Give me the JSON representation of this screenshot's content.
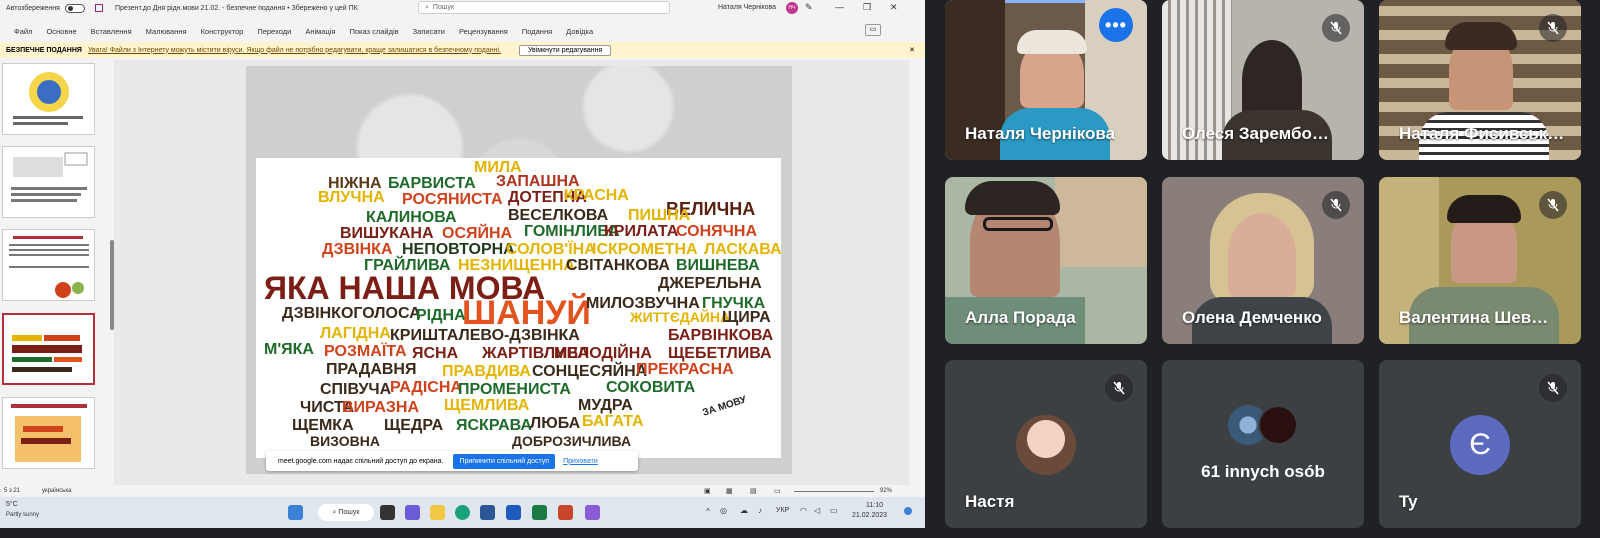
{
  "titlebar": {
    "autosave_label": "Автозбереження",
    "doc_title": "Презент.до Дня рідн.мови 21.02. - безпечне подання • Збережено у цей ПК",
    "search_placeholder": "Пошук",
    "user_name": "Наталя Чернікова",
    "user_initials": "НЧ"
  },
  "ribbon": {
    "tabs": [
      "Файл",
      "Основне",
      "Вставлення",
      "Малювання",
      "Конструктор",
      "Переходи",
      "Анімація",
      "Показ слайдів",
      "Записати",
      "Рецензування",
      "Подання",
      "Довідка"
    ]
  },
  "infobar": {
    "title": "БЕЗПЕЧНЕ ПОДАННЯ",
    "message": "Увага! Файли з Інтернету можуть містити віруси. Якщо файл не потрібно редагувати, краще залишатися в безпечному поданні.",
    "enable_button": "Увімкнути редагування"
  },
  "slide": {
    "words": [
      {
        "t": "МИЛА",
        "c": "#e3b400"
      },
      {
        "t": "НІЖНА",
        "c": "#5a3b1b"
      },
      {
        "t": "БАРВИСТА",
        "c": "#1f6b2b"
      },
      {
        "t": "ЗАПАШНА",
        "c": "#b0331e"
      },
      {
        "t": "ВЛУЧНА",
        "c": "#e3b400"
      },
      {
        "t": "РОСЯНИСТА",
        "c": "#d0421b"
      },
      {
        "t": "ДОТЕПНА",
        "c": "#7a1e16"
      },
      {
        "t": "КРАСНА",
        "c": "#e3b400"
      },
      {
        "t": "ВЕЛИЧНА",
        "c": "#5a2010"
      },
      {
        "t": "КАЛИНОВА",
        "c": "#1f6b2b"
      },
      {
        "t": "ВЕСЕЛКОВА",
        "c": "#3b2a1a"
      },
      {
        "t": "ПИШНА",
        "c": "#e3b400"
      },
      {
        "t": "ВИШУКАНА",
        "c": "#7a1e16"
      },
      {
        "t": "ОСЯЙНА",
        "c": "#d0421b"
      },
      {
        "t": "ГОМІНЛИВА",
        "c": "#1f6b2b"
      },
      {
        "t": "КРИЛАТА",
        "c": "#7a1e16"
      },
      {
        "t": "СОНЯЧНА",
        "c": "#d0421b"
      },
      {
        "t": "ДЗВІНКА",
        "c": "#d0421b"
      },
      {
        "t": "НЕПОВТОРНА",
        "c": "#1f3b1b"
      },
      {
        "t": "СОЛОВ'ЇНА",
        "c": "#e3b400"
      },
      {
        "t": "ІСКРОМЕТНА",
        "c": "#e3b400"
      },
      {
        "t": "ЛАСКАВА",
        "c": "#e3b400"
      },
      {
        "t": "ГРАЙЛИВА",
        "c": "#1f6b2b"
      },
      {
        "t": "НЕЗНИЩЕННА",
        "c": "#e3b400"
      },
      {
        "t": "СВІТАНКОВА",
        "c": "#3b2a1a"
      },
      {
        "t": "ВИШНЕВА",
        "c": "#1f6b2b"
      },
      {
        "t": "ЯКА НАША МОВА",
        "c": "#7a1e16"
      },
      {
        "t": "ДЖЕРЕЛЬНА",
        "c": "#3b2a1a"
      },
      {
        "t": "ДЗВІНКОГОЛОСА",
        "c": "#3b2a1a"
      },
      {
        "t": "РІДНА",
        "c": "#1f6b2b"
      },
      {
        "t": "ШАНУЙ",
        "c": "#e3531e"
      },
      {
        "t": "МИЛОЗВУЧНА",
        "c": "#3b2a1a"
      },
      {
        "t": "ГНУЧКА",
        "c": "#1f6b2b"
      },
      {
        "t": "ЖИТТЄДАЙНА",
        "c": "#e3b400"
      },
      {
        "t": "ЩИРА",
        "c": "#3b2a1a"
      },
      {
        "t": "ЛАГІДНА",
        "c": "#e3b400"
      },
      {
        "t": "КРИШТАЛЕВО-ДЗВІНКА",
        "c": "#3b2a1a"
      },
      {
        "t": "БАРВІНКОВА",
        "c": "#7a1e16"
      },
      {
        "t": "М'ЯКА",
        "c": "#1f6b2b"
      },
      {
        "t": "РОЗМАЇТА",
        "c": "#d0421b"
      },
      {
        "t": "ЯСНА",
        "c": "#7a1e16"
      },
      {
        "t": "ЖАРТІВЛИВА",
        "c": "#7a1e16"
      },
      {
        "t": "МЕЛОДІЙНА",
        "c": "#7a1e16"
      },
      {
        "t": "ЩЕБЕТЛИВА",
        "c": "#7a1e16"
      },
      {
        "t": "ПРАДАВНЯ",
        "c": "#3b2a1a"
      },
      {
        "t": "ПРАВДИВА",
        "c": "#e3b400"
      },
      {
        "t": "СОНЦЕСЯЙНА",
        "c": "#3b2a1a"
      },
      {
        "t": "ПРЕКРАСНА",
        "c": "#d0421b"
      },
      {
        "t": "СПІВУЧА",
        "c": "#3b2a1a"
      },
      {
        "t": "РАДІСНА",
        "c": "#d0421b"
      },
      {
        "t": "ПРОМЕНИСТА",
        "c": "#1f6b2b"
      },
      {
        "t": "СОКОВИТА",
        "c": "#1f6b2b"
      },
      {
        "t": "ЧИСТА",
        "c": "#3b2a1a"
      },
      {
        "t": "ВИРАЗНА",
        "c": "#d0421b"
      },
      {
        "t": "ЩЕМЛИВА",
        "c": "#e3b400"
      },
      {
        "t": "МУДРА",
        "c": "#3b2a1a"
      },
      {
        "t": "ЩЕМКА",
        "c": "#3b2a1a"
      },
      {
        "t": "ЩЕДРА",
        "c": "#3b2a1a"
      },
      {
        "t": "ЯСКРАВА",
        "c": "#1f6b2b"
      },
      {
        "t": "ЛЮБА",
        "c": "#3b2a1a"
      },
      {
        "t": "БАГАТА",
        "c": "#e3b400"
      },
      {
        "t": "ВИЗОВНА",
        "c": "#3b2a1a"
      },
      {
        "t": "ДОБРОЗИЧЛИВА",
        "c": "#3b2a1a"
      }
    ],
    "logo_text": "ЗА МОВУ"
  },
  "share_bar": {
    "message": "meet.google.com надає спільний доступ до екрана.",
    "stop_button": "Припинити спільний доступ",
    "hide_link": "Приховати"
  },
  "statusbar": {
    "slide_info": "5 з 21",
    "language": "українська",
    "zoom": "92%"
  },
  "taskbar": {
    "weather_temp": "5°C",
    "weather_desc": "Partly sunny",
    "search_label": "Пошук",
    "lang": "УКР",
    "time": "11:10",
    "date": "21.02.2023"
  },
  "participants": [
    {
      "name": "Наталя Чернікова",
      "muted": false,
      "speaking": true
    },
    {
      "name": "Олеся Зарембо…",
      "muted": true
    },
    {
      "name": "Наталя Фисивськ…",
      "muted": true
    },
    {
      "name": "Алла Порада",
      "muted": false
    },
    {
      "name": "Олена Демченко",
      "muted": true
    },
    {
      "name": "Валентина Шев…",
      "muted": true
    },
    {
      "name": "Настя",
      "muted": true
    },
    {
      "name": "",
      "others_label": "61 innych osób"
    },
    {
      "name": "Ty",
      "muted": true,
      "avatar_letter": "Є"
    }
  ],
  "colors": {
    "meet_bg": "#202124",
    "tile_bg": "#3c4043",
    "accent": "#1a73e8",
    "self_avatar": "#5c6bc0",
    "infobar_bg": "#fff4ce"
  }
}
